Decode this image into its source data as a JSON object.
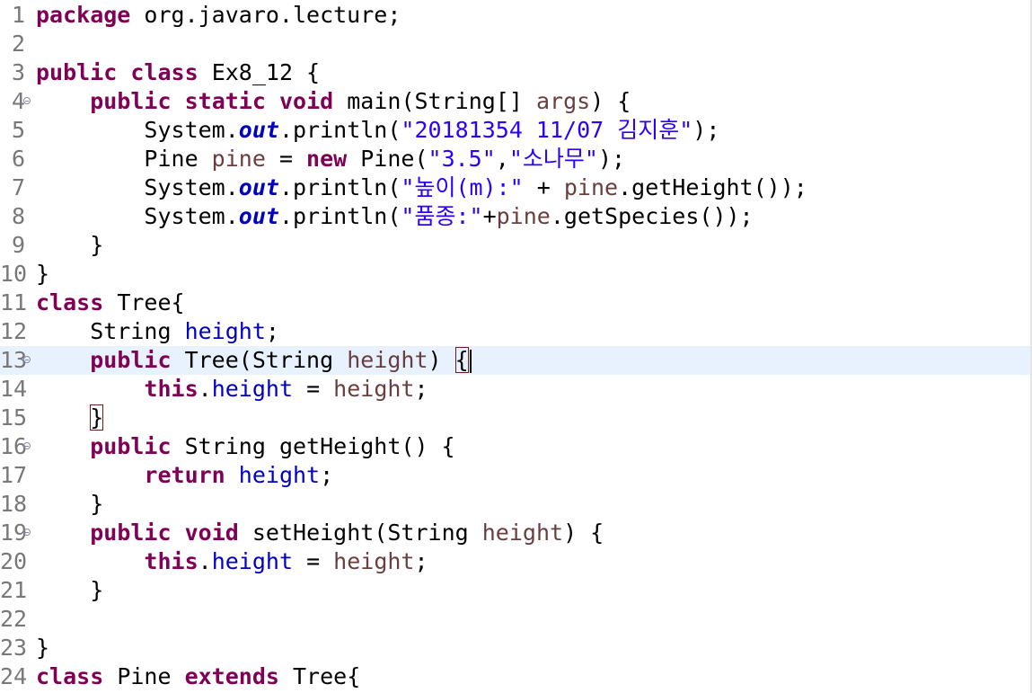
{
  "editor": {
    "lines": [
      {
        "num": "1",
        "fold": false,
        "tokens": [
          {
            "t": "package",
            "c": "kw"
          },
          {
            "t": " org.javaro.lecture;",
            "c": "p"
          }
        ]
      },
      {
        "num": "2",
        "fold": false,
        "tokens": []
      },
      {
        "num": "3",
        "fold": false,
        "tokens": [
          {
            "t": "public",
            "c": "kw"
          },
          {
            "t": " ",
            "c": "p"
          },
          {
            "t": "class",
            "c": "kw"
          },
          {
            "t": " Ex8_12 {",
            "c": "p"
          }
        ]
      },
      {
        "num": "4",
        "fold": true,
        "tokens": [
          {
            "t": "    ",
            "c": "p"
          },
          {
            "t": "public",
            "c": "kw"
          },
          {
            "t": " ",
            "c": "p"
          },
          {
            "t": "static",
            "c": "kw"
          },
          {
            "t": " ",
            "c": "p"
          },
          {
            "t": "void",
            "c": "kw"
          },
          {
            "t": " main(String[] ",
            "c": "p"
          },
          {
            "t": "args",
            "c": "var"
          },
          {
            "t": ") {",
            "c": "p"
          }
        ]
      },
      {
        "num": "5",
        "fold": false,
        "tokens": [
          {
            "t": "        System.",
            "c": "p"
          },
          {
            "t": "out",
            "c": "sfld"
          },
          {
            "t": ".println(",
            "c": "p"
          },
          {
            "t": "\"20181354 11/07 김지훈\"",
            "c": "str"
          },
          {
            "t": ");",
            "c": "p"
          }
        ]
      },
      {
        "num": "6",
        "fold": false,
        "tokens": [
          {
            "t": "        Pine ",
            "c": "p"
          },
          {
            "t": "pine",
            "c": "var"
          },
          {
            "t": " = ",
            "c": "p"
          },
          {
            "t": "new",
            "c": "kw"
          },
          {
            "t": " Pine(",
            "c": "p"
          },
          {
            "t": "\"3.5\"",
            "c": "str"
          },
          {
            "t": ",",
            "c": "p"
          },
          {
            "t": "\"소나무\"",
            "c": "str"
          },
          {
            "t": ");",
            "c": "p"
          }
        ]
      },
      {
        "num": "7",
        "fold": false,
        "tokens": [
          {
            "t": "        System.",
            "c": "p"
          },
          {
            "t": "out",
            "c": "sfld"
          },
          {
            "t": ".println(",
            "c": "p"
          },
          {
            "t": "\"높이(m):\"",
            "c": "str"
          },
          {
            "t": " + ",
            "c": "p"
          },
          {
            "t": "pine",
            "c": "var"
          },
          {
            "t": ".getHeight());",
            "c": "p"
          }
        ]
      },
      {
        "num": "8",
        "fold": false,
        "tokens": [
          {
            "t": "        System.",
            "c": "p"
          },
          {
            "t": "out",
            "c": "sfld"
          },
          {
            "t": ".println(",
            "c": "p"
          },
          {
            "t": "\"품종:\"",
            "c": "str"
          },
          {
            "t": "+",
            "c": "p"
          },
          {
            "t": "pine",
            "c": "var"
          },
          {
            "t": ".getSpecies());",
            "c": "p"
          }
        ]
      },
      {
        "num": "9",
        "fold": false,
        "tokens": [
          {
            "t": "    }",
            "c": "p"
          }
        ]
      },
      {
        "num": "10",
        "fold": false,
        "tokens": [
          {
            "t": "}",
            "c": "p"
          }
        ]
      },
      {
        "num": "11",
        "fold": false,
        "tokens": [
          {
            "t": "class",
            "c": "kw"
          },
          {
            "t": " Tree{",
            "c": "p"
          }
        ]
      },
      {
        "num": "12",
        "fold": false,
        "tokens": [
          {
            "t": "    String ",
            "c": "p"
          },
          {
            "t": "height",
            "c": "fld"
          },
          {
            "t": ";",
            "c": "p"
          }
        ]
      },
      {
        "num": "13",
        "fold": true,
        "current": true,
        "tokens": [
          {
            "t": "    ",
            "c": "p"
          },
          {
            "t": "public",
            "c": "kw"
          },
          {
            "t": " Tree(String ",
            "c": "p"
          },
          {
            "t": "height",
            "c": "var"
          },
          {
            "t": ") ",
            "c": "p"
          },
          {
            "t": "{",
            "c": "bm"
          },
          {
            "t": "",
            "c": "caret"
          }
        ]
      },
      {
        "num": "14",
        "fold": false,
        "tokens": [
          {
            "t": "        ",
            "c": "p"
          },
          {
            "t": "this",
            "c": "kw"
          },
          {
            "t": ".",
            "c": "p"
          },
          {
            "t": "height",
            "c": "fld"
          },
          {
            "t": " = ",
            "c": "p"
          },
          {
            "t": "height",
            "c": "var"
          },
          {
            "t": ";",
            "c": "p"
          }
        ]
      },
      {
        "num": "15",
        "fold": false,
        "tokens": [
          {
            "t": "    ",
            "c": "p"
          },
          {
            "t": "}",
            "c": "bm"
          }
        ]
      },
      {
        "num": "16",
        "fold": true,
        "tokens": [
          {
            "t": "    ",
            "c": "p"
          },
          {
            "t": "public",
            "c": "kw"
          },
          {
            "t": " String getHeight() {",
            "c": "p"
          }
        ]
      },
      {
        "num": "17",
        "fold": false,
        "tokens": [
          {
            "t": "        ",
            "c": "p"
          },
          {
            "t": "return",
            "c": "kw"
          },
          {
            "t": " ",
            "c": "p"
          },
          {
            "t": "height",
            "c": "fld"
          },
          {
            "t": ";",
            "c": "p"
          }
        ]
      },
      {
        "num": "18",
        "fold": false,
        "tokens": [
          {
            "t": "    }",
            "c": "p"
          }
        ]
      },
      {
        "num": "19",
        "fold": true,
        "tokens": [
          {
            "t": "    ",
            "c": "p"
          },
          {
            "t": "public",
            "c": "kw"
          },
          {
            "t": " ",
            "c": "p"
          },
          {
            "t": "void",
            "c": "kw"
          },
          {
            "t": " setHeight(String ",
            "c": "p"
          },
          {
            "t": "height",
            "c": "var"
          },
          {
            "t": ") {",
            "c": "p"
          }
        ]
      },
      {
        "num": "20",
        "fold": false,
        "tokens": [
          {
            "t": "        ",
            "c": "p"
          },
          {
            "t": "this",
            "c": "kw"
          },
          {
            "t": ".",
            "c": "p"
          },
          {
            "t": "height",
            "c": "fld"
          },
          {
            "t": " = ",
            "c": "p"
          },
          {
            "t": "height",
            "c": "var"
          },
          {
            "t": ";",
            "c": "p"
          }
        ]
      },
      {
        "num": "21",
        "fold": false,
        "tokens": [
          {
            "t": "    }",
            "c": "p"
          }
        ]
      },
      {
        "num": "22",
        "fold": false,
        "tokens": []
      },
      {
        "num": "23",
        "fold": false,
        "tokens": [
          {
            "t": "}",
            "c": "p"
          }
        ]
      },
      {
        "num": "24",
        "fold": false,
        "tokens": [
          {
            "t": "class",
            "c": "kw"
          },
          {
            "t": " Pine ",
            "c": "p"
          },
          {
            "t": "extends",
            "c": "kw"
          },
          {
            "t": " Tree{",
            "c": "p"
          }
        ]
      }
    ]
  },
  "colors": {
    "keyword": "#7f0055",
    "string": "#2a00ff",
    "field": "#0000c0",
    "local_variable": "#6a3e3e",
    "line_number": "#787878",
    "current_line_highlight": "#e8f2fe",
    "background": "#ffffff"
  },
  "icons": {
    "fold": "collapse-fold-icon"
  }
}
